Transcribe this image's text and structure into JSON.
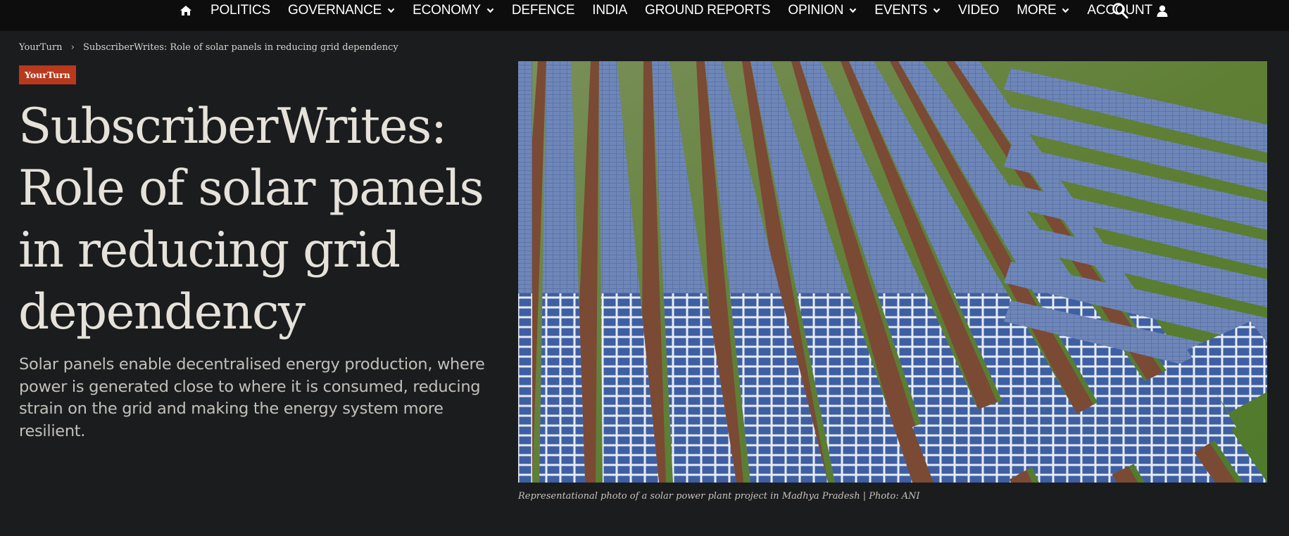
{
  "nav": {
    "items": [
      {
        "label": "POLITICS",
        "dropdown": false
      },
      {
        "label": "GOVERNANCE",
        "dropdown": true
      },
      {
        "label": "ECONOMY",
        "dropdown": true
      },
      {
        "label": "DEFENCE",
        "dropdown": false
      },
      {
        "label": "INDIA",
        "dropdown": false
      },
      {
        "label": "GROUND REPORTS",
        "dropdown": false
      },
      {
        "label": "OPINION",
        "dropdown": true
      },
      {
        "label": "EVENTS",
        "dropdown": true
      },
      {
        "label": "VIDEO",
        "dropdown": false
      },
      {
        "label": "MORE",
        "dropdown": true
      }
    ],
    "account_label": "ACCOUNT",
    "icons": {
      "home": "home-icon",
      "search": "search-icon",
      "user": "user-icon",
      "dropdown": "chevron-down-icon"
    }
  },
  "breadcrumb": {
    "section": "YourTurn",
    "separator": "›",
    "current": "SubscriberWrites: Role of solar panels in reducing grid dependency"
  },
  "article": {
    "tag": "YourTurn",
    "headline": "SubscriberWrites: Role of solar panels in reducing grid dependency",
    "dek": "Solar panels enable decentralised energy production, where power is generated close to where it is consumed, reducing strain on the grid and making the energy system more resilient.",
    "image_caption": "Representational photo of a solar power plant project in Madhya Pradesh | Photo: ANI"
  },
  "colors": {
    "page_background": "#1b1c1e",
    "nav_background": "#0d0d0e",
    "tag_background": "#b8391d",
    "headline_text": "#e6e2da",
    "dek_text": "#c3c0ba"
  }
}
